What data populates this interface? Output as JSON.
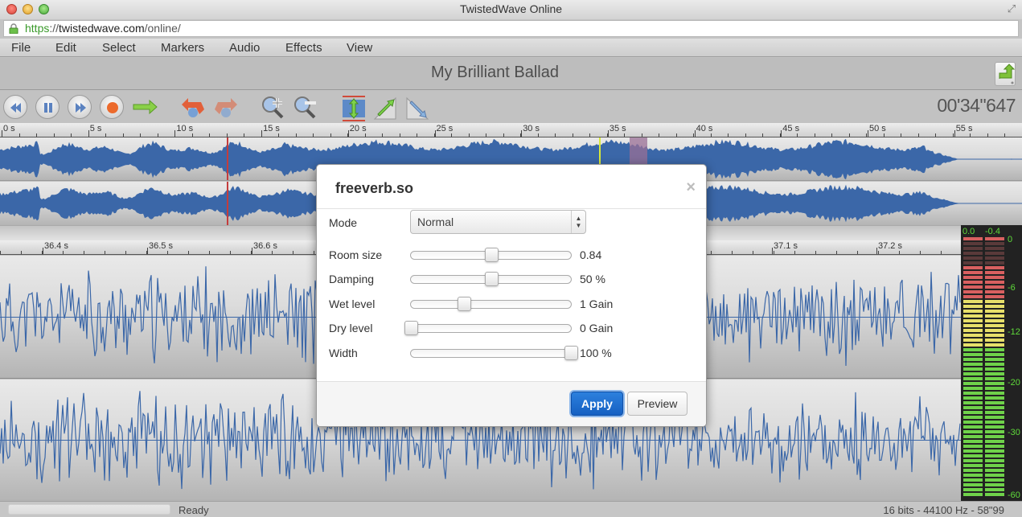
{
  "window": {
    "title": "TwistedWave Online"
  },
  "urlbar": {
    "scheme": "https",
    "separator": "://",
    "host": "twistedwave.com",
    "path": "/online/"
  },
  "menu": [
    "File",
    "Edit",
    "Select",
    "Markers",
    "Audio",
    "Effects",
    "View"
  ],
  "document": {
    "title": "My Brilliant Ballad"
  },
  "toolbar": {
    "buttons": [
      "rewind",
      "pause",
      "fast-forward",
      "record",
      "play-from-cursor",
      "undo",
      "redo",
      "zoom-in",
      "zoom-out",
      "fit-vertical",
      "fade-in",
      "fade-out"
    ],
    "time_readout": "00'34\"647"
  },
  "overview_ruler": {
    "labels": [
      "0 s",
      "5 s",
      "10 s",
      "15 s",
      "20 s",
      "25 s",
      "30 s",
      "35 s",
      "40 s",
      "45 s",
      "50 s",
      "55 s"
    ]
  },
  "detail_ruler": {
    "labels": [
      "36.4 s",
      "36.5 s",
      "36.6 s",
      "37.1 s",
      "37.2 s"
    ]
  },
  "meter": {
    "peak_left": "0.0",
    "peak_right": "-0.4",
    "scale": [
      "0",
      "-6",
      "-12",
      "-20",
      "-30",
      "-60"
    ],
    "colors": {
      "red": "#d96060",
      "yellow": "#e7df6a",
      "green": "#6fd24a"
    }
  },
  "status": {
    "text": "Ready",
    "format": "16 bits - 44100 Hz - 58\"99"
  },
  "dialog": {
    "title": "freeverb.so",
    "close_glyph": "×",
    "mode": {
      "label": "Mode",
      "value": "Normal"
    },
    "sliders": [
      {
        "label": "Room size",
        "value": "0.84",
        "fraction": 0.5
      },
      {
        "label": "Damping",
        "value": "50 %",
        "fraction": 0.5
      },
      {
        "label": "Wet level",
        "value": "1 Gain",
        "fraction": 0.33
      },
      {
        "label": "Dry level",
        "value": "0 Gain",
        "fraction": 0.0
      },
      {
        "label": "Width",
        "value": "100 %",
        "fraction": 1.0
      }
    ],
    "apply_label": "Apply",
    "preview_label": "Preview"
  },
  "colors": {
    "waveform": "#3b67a8",
    "playhead": "#c43c3c",
    "cursor": "#d8e83a",
    "selection": "#9a6f95",
    "accent": "#1e6fd0"
  }
}
